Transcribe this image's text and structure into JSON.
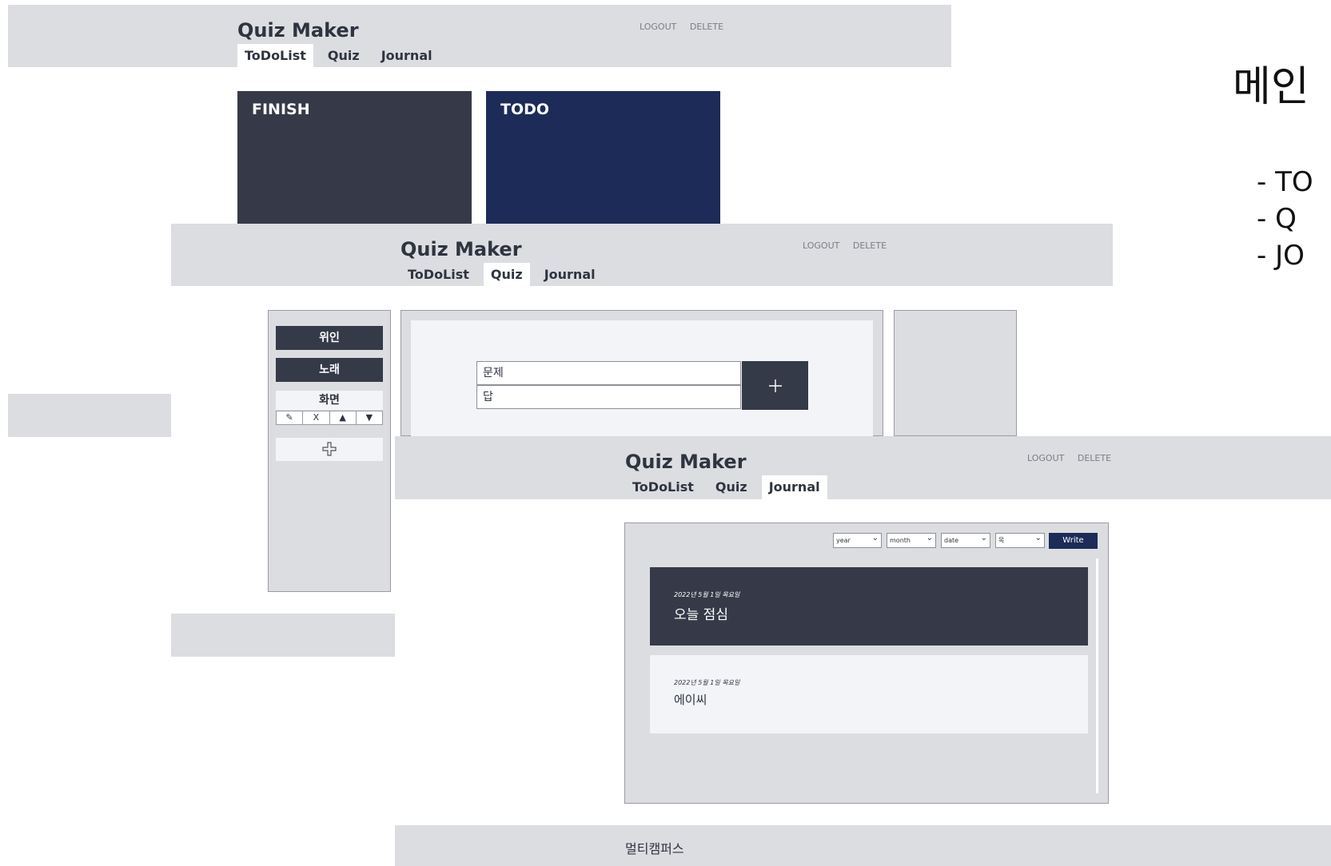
{
  "app": {
    "title": "Quiz Maker",
    "logout_label": "LOGOUT",
    "delete_label": "DELETE"
  },
  "tabs": [
    "ToDoList",
    "Quiz",
    "Journal"
  ],
  "todo": {
    "finish_label": "FINISH",
    "todo_label": "TODO"
  },
  "quiz": {
    "categories": [
      "위인",
      "노래",
      "화면"
    ],
    "controls": [
      "✎",
      "X",
      "▲",
      "▼"
    ],
    "add_icon": "plus-icon",
    "question_placeholder": "문제",
    "answer_placeholder": "답",
    "submit_icon": "plus-icon"
  },
  "journal": {
    "selects": [
      "year",
      "month",
      "date",
      "목"
    ],
    "write_label": "Write",
    "entries": [
      {
        "date": "2022년 5월 1일 목요일",
        "title": "오늘 점심"
      },
      {
        "date": "2022년 5월 1일 목요일",
        "title": "에이씨"
      }
    ]
  },
  "footer": {
    "text": "멀티캠퍼스"
  },
  "side_title": "메인",
  "side_list": [
    "- TO",
    "- Q",
    "- JO"
  ],
  "colors": {
    "header_bg": "#dcdde1",
    "finish_card": "#363a48",
    "todo_card": "#1c2b58",
    "write_button": "#1c2b58",
    "dark_entry": "#363a48"
  }
}
